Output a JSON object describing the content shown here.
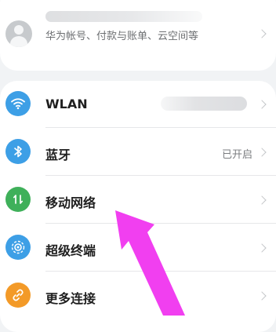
{
  "account": {
    "subtitle": "华为帐号、付款与账单、云空间等"
  },
  "settings": [
    {
      "label": "WLAN",
      "value": "",
      "icon": "wifi-icon",
      "color": "#3d9fe6"
    },
    {
      "label": "蓝牙",
      "value": "已开启",
      "icon": "bluetooth-icon",
      "color": "#3d9fe6"
    },
    {
      "label": "移动网络",
      "value": "",
      "icon": "mobile-data-icon",
      "color": "#3fb05a"
    },
    {
      "label": "超级终端",
      "value": "",
      "icon": "super-device-icon",
      "color": "#3d9fe6"
    },
    {
      "label": "更多连接",
      "value": "",
      "icon": "link-icon",
      "color": "#f39a28"
    }
  ],
  "annotation": {
    "arrow_color": "#f13ff0"
  }
}
